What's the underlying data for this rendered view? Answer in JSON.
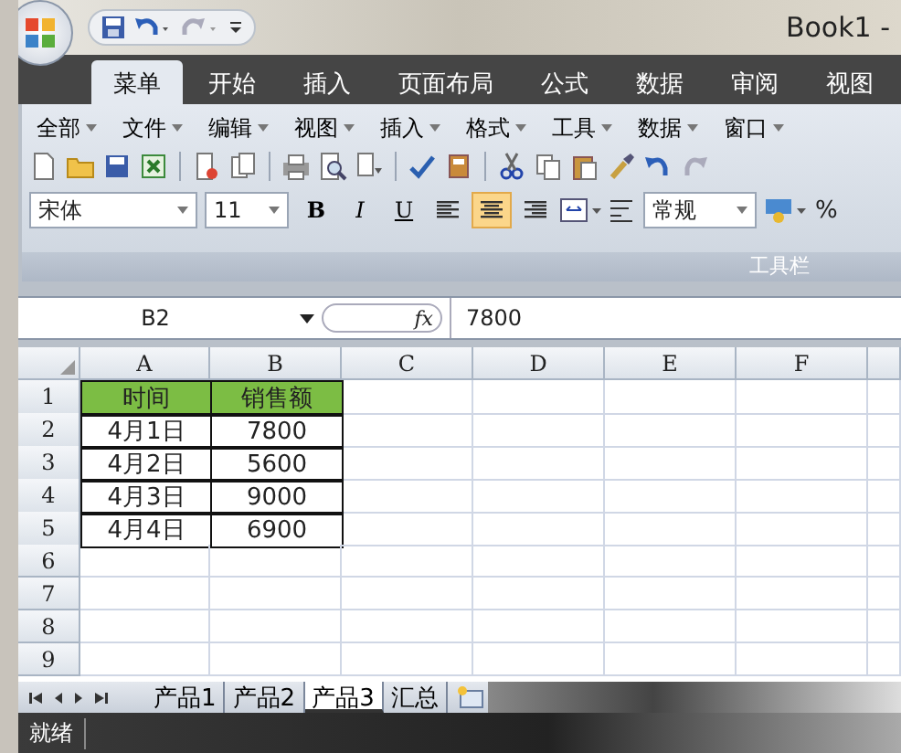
{
  "window": {
    "title": "Book1 -"
  },
  "ribbon_tabs": [
    {
      "label": "菜单",
      "selected": true
    },
    {
      "label": "开始",
      "selected": false
    },
    {
      "label": "插入",
      "selected": false
    },
    {
      "label": "页面布局",
      "selected": false
    },
    {
      "label": "公式",
      "selected": false
    },
    {
      "label": "数据",
      "selected": false
    },
    {
      "label": "审阅",
      "selected": false
    },
    {
      "label": "视图",
      "selected": false
    }
  ],
  "menu": [
    {
      "label": "全部"
    },
    {
      "label": "文件"
    },
    {
      "label": "编辑"
    },
    {
      "label": "视图"
    },
    {
      "label": "插入"
    },
    {
      "label": "格式"
    },
    {
      "label": "工具"
    },
    {
      "label": "数据"
    },
    {
      "label": "窗口"
    }
  ],
  "toolbar": {
    "font": "宋体",
    "size": "11",
    "number_format": "常规",
    "percent": "%",
    "format_buttons": [
      {
        "label": "B",
        "selected": false
      },
      {
        "label": "I",
        "selected": false
      },
      {
        "label": "U",
        "selected": false
      }
    ],
    "align_buttons": [
      {
        "kind": "left",
        "selected": false
      },
      {
        "kind": "center",
        "selected": true
      },
      {
        "kind": "right",
        "selected": false
      }
    ],
    "group_label": "工具栏"
  },
  "formula_bar": {
    "name_box": "B2",
    "function_label": "fx",
    "value": "7800"
  },
  "sheet": {
    "columns": [
      "A",
      "B",
      "C",
      "D",
      "E",
      "F"
    ],
    "rows": [
      {
        "number": "1",
        "kind": "header",
        "cells": [
          "时间",
          "销售额"
        ]
      },
      {
        "number": "2",
        "kind": "data",
        "cells": [
          "4月1日",
          "7800"
        ]
      },
      {
        "number": "3",
        "kind": "data",
        "cells": [
          "4月2日",
          "5600"
        ]
      },
      {
        "number": "4",
        "kind": "data",
        "cells": [
          "4月3日",
          "9000"
        ]
      },
      {
        "number": "5",
        "kind": "data",
        "cells": [
          "4月4日",
          "6900"
        ]
      },
      {
        "number": "6",
        "kind": "empty",
        "cells": []
      },
      {
        "number": "7",
        "kind": "empty",
        "cells": []
      },
      {
        "number": "8",
        "kind": "empty",
        "cells": []
      },
      {
        "number": "9",
        "kind": "empty",
        "cells": []
      }
    ]
  },
  "sheet_tabs": [
    {
      "label": "产品1",
      "selected": false
    },
    {
      "label": "产品2",
      "selected": false
    },
    {
      "label": "产品3",
      "selected": true
    },
    {
      "label": "汇总",
      "selected": false
    }
  ],
  "status_bar": {
    "text": "就绪"
  }
}
